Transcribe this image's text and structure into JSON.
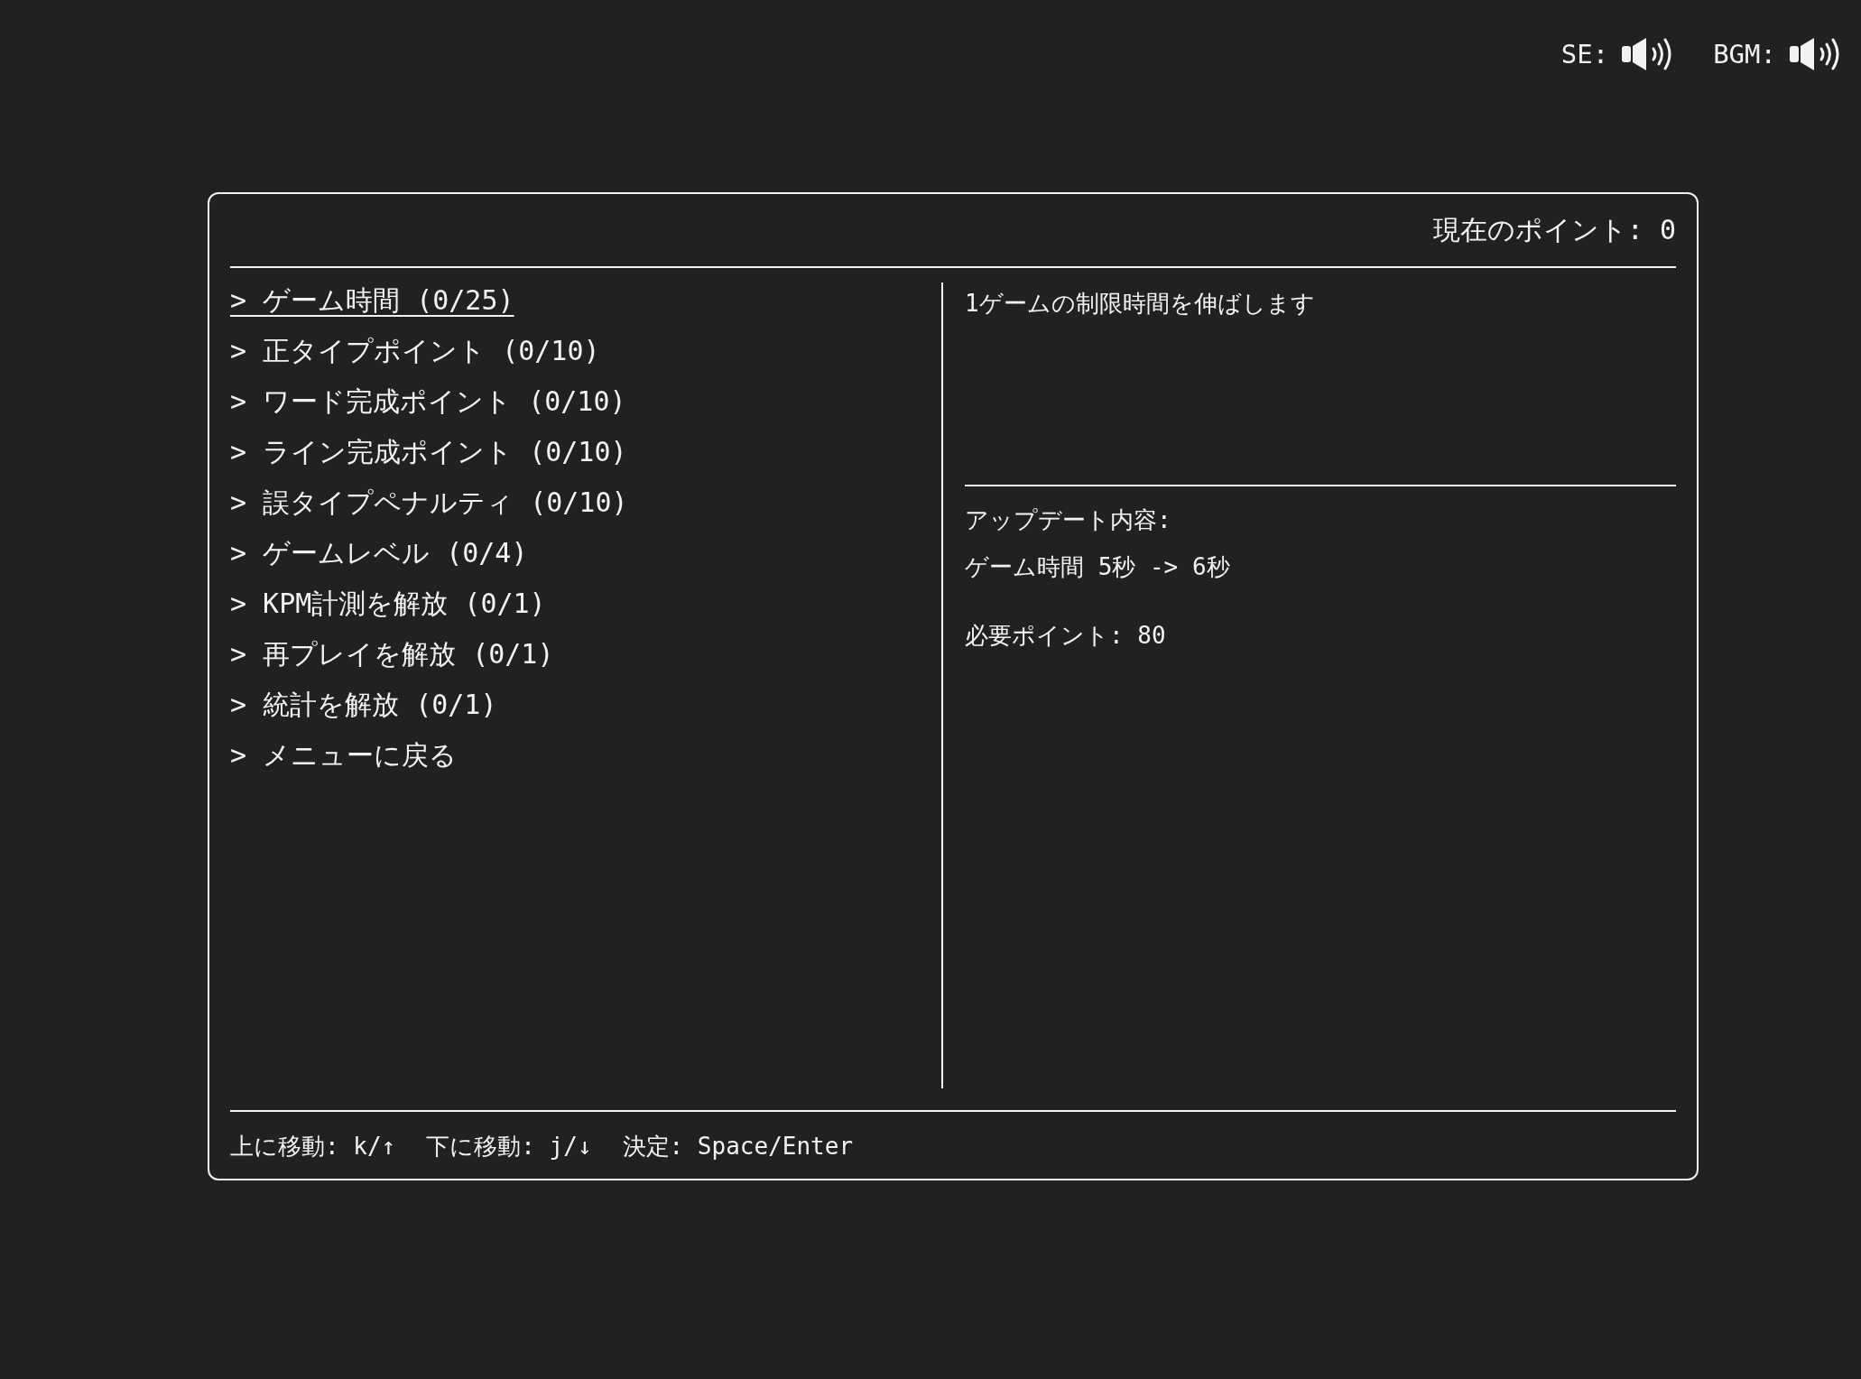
{
  "sound_toggles": [
    {
      "label": "SE:",
      "on": true
    },
    {
      "label": "BGM:",
      "on": true
    }
  ],
  "points_label": "現在のポイント: 0",
  "upgrades": [
    {
      "label": "> ゲーム時間 (0/25)",
      "selected": true
    },
    {
      "label": "> 正タイプポイント (0/10)",
      "selected": false
    },
    {
      "label": "> ワード完成ポイント (0/10)",
      "selected": false
    },
    {
      "label": "> ライン完成ポイント (0/10)",
      "selected": false
    },
    {
      "label": "> 誤タイプペナルティ (0/10)",
      "selected": false
    },
    {
      "label": "> ゲームレベル (0/4)",
      "selected": false
    },
    {
      "label": "> KPM計測を解放 (0/1)",
      "selected": false
    },
    {
      "label": "> 再プレイを解放 (0/1)",
      "selected": false
    },
    {
      "label": "> 統計を解放 (0/1)",
      "selected": false
    },
    {
      "label": "> メニューに戻る",
      "selected": false
    }
  ],
  "detail": {
    "description": "1ゲームの制限時間を伸ばします",
    "update_heading": "アップデート内容:",
    "update_text": "ゲーム時間 5秒 -> 6秒",
    "cost": "必要ポイント: 80"
  },
  "key_hints": [
    "上に移動: k/↑",
    "下に移動: j/↓",
    "決定: Space/Enter"
  ]
}
